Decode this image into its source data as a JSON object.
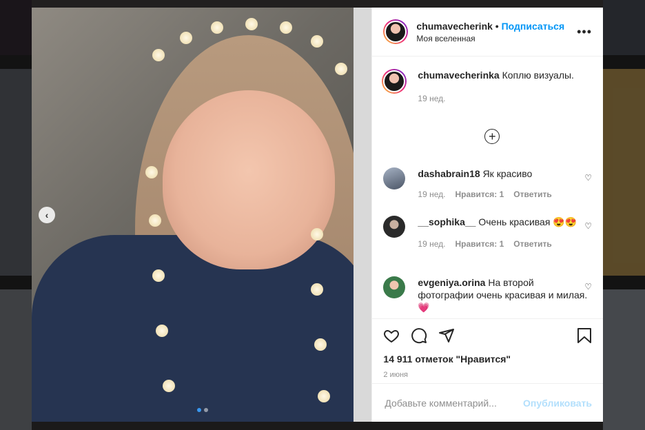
{
  "post": {
    "username": "chumavecherink",
    "separator": " • ",
    "follow_label": "Подписаться",
    "subtitle": "Моя вселенная",
    "more_label": "•••"
  },
  "caption": {
    "username": "chumavecherinka",
    "text": "Коплю визуалы.",
    "time": "19 нед."
  },
  "comments": [
    {
      "username": "dashabrain18",
      "text": "Як красиво",
      "time": "19 нед.",
      "likes": "Нравится: 1",
      "reply": "Ответить"
    },
    {
      "username": "__sophika__",
      "text": "Очень красивая 😍😍",
      "time": "19 нед.",
      "likes": "Нравится: 1",
      "reply": "Ответить"
    },
    {
      "username": "evgeniya.orina",
      "text": "На второй фотографии очень красивая и милая. 💗"
    }
  ],
  "likes_text": "14 911 отметок \"Нравится\"",
  "date_text": "2 июня",
  "add_comment": {
    "placeholder": "Добавьте комментарий...",
    "publish_label": "Опубликовать"
  },
  "colors": {
    "accent": "#0095f6",
    "publish_disabled": "#b2dffc",
    "meta_gray": "#8e8e8e"
  },
  "carousel": {
    "slide_count": 2,
    "active_index": 1
  }
}
